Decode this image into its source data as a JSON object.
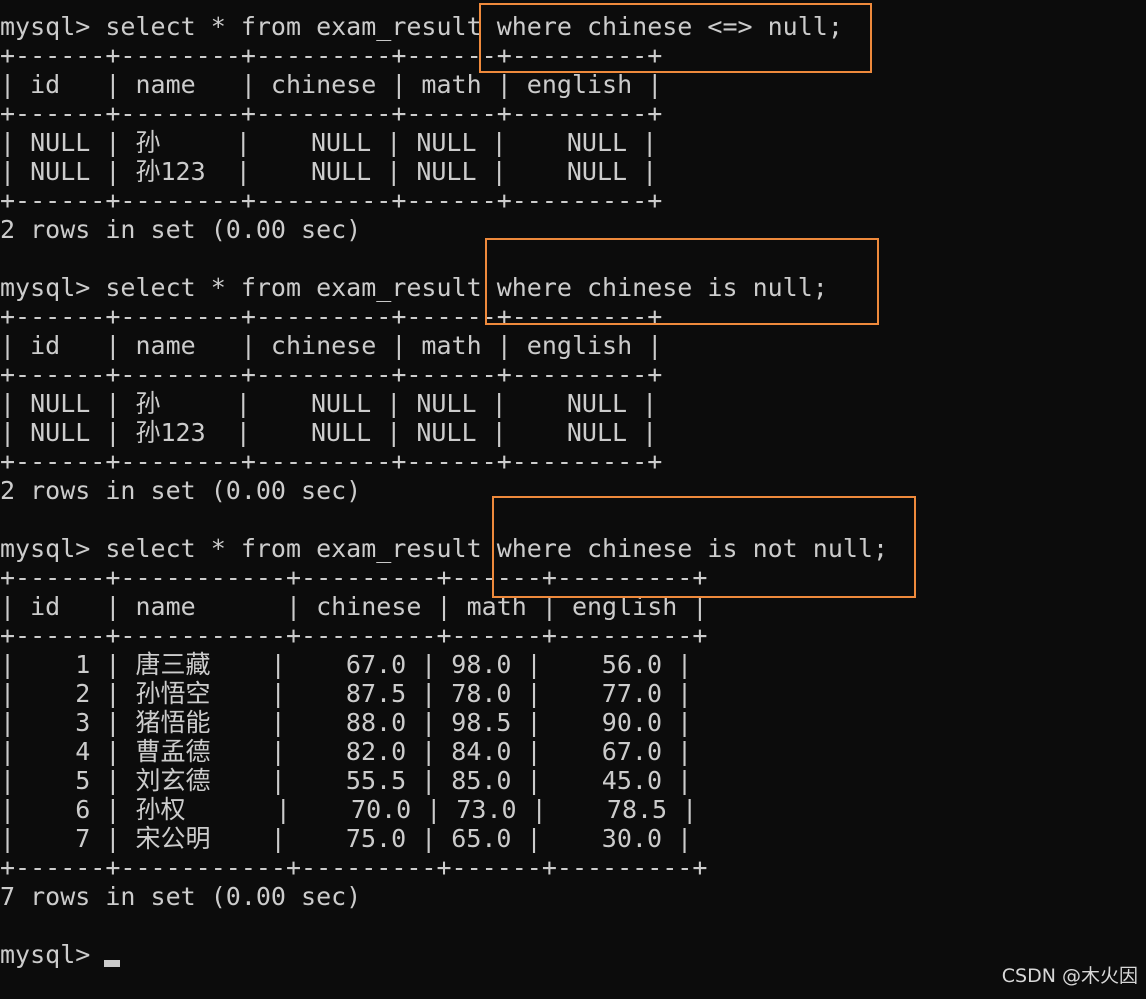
{
  "terminal": {
    "lines": [
      "mysql> select * from exam_result where chinese <=> null;",
      "+------+--------+---------+------+---------+",
      "| id   | name   | chinese | math | english |",
      "+------+--------+---------+------+---------+",
      "| NULL | 孙     |    NULL | NULL |    NULL |",
      "| NULL | 孙123  |    NULL | NULL |    NULL |",
      "+------+--------+---------+------+---------+",
      "2 rows in set (0.00 sec)",
      "",
      "mysql> select * from exam_result where chinese is null;",
      "+------+--------+---------+------+---------+",
      "| id   | name   | chinese | math | english |",
      "+------+--------+---------+------+---------+",
      "| NULL | 孙     |    NULL | NULL |    NULL |",
      "| NULL | 孙123  |    NULL | NULL |    NULL |",
      "+------+--------+---------+------+---------+",
      "2 rows in set (0.00 sec)",
      "",
      "mysql> select * from exam_result where chinese is not null;",
      "+------+-----------+---------+------+---------+",
      "| id   | name      | chinese | math | english |",
      "+------+-----------+---------+------+---------+",
      "|    1 | 唐三藏    |    67.0 | 98.0 |    56.0 |",
      "|    2 | 孙悟空    |    87.5 | 78.0 |    77.0 |",
      "|    3 | 猪悟能    |    88.0 | 98.5 |    90.0 |",
      "|    4 | 曹孟德    |    82.0 | 84.0 |    67.0 |",
      "|    5 | 刘玄德    |    55.5 | 85.0 |    45.0 |",
      "|    6 | 孙权      |    70.0 | 73.0 |    78.5 |",
      "|    7 | 宋公明    |    75.0 | 65.0 |    30.0 |",
      "+------+-----------+---------+------+---------+",
      "7 rows in set (0.00 sec)",
      "",
      "mysql> "
    ]
  },
  "watermark": "CSDN @木火因",
  "highlight_color": "#ef8a3c"
}
